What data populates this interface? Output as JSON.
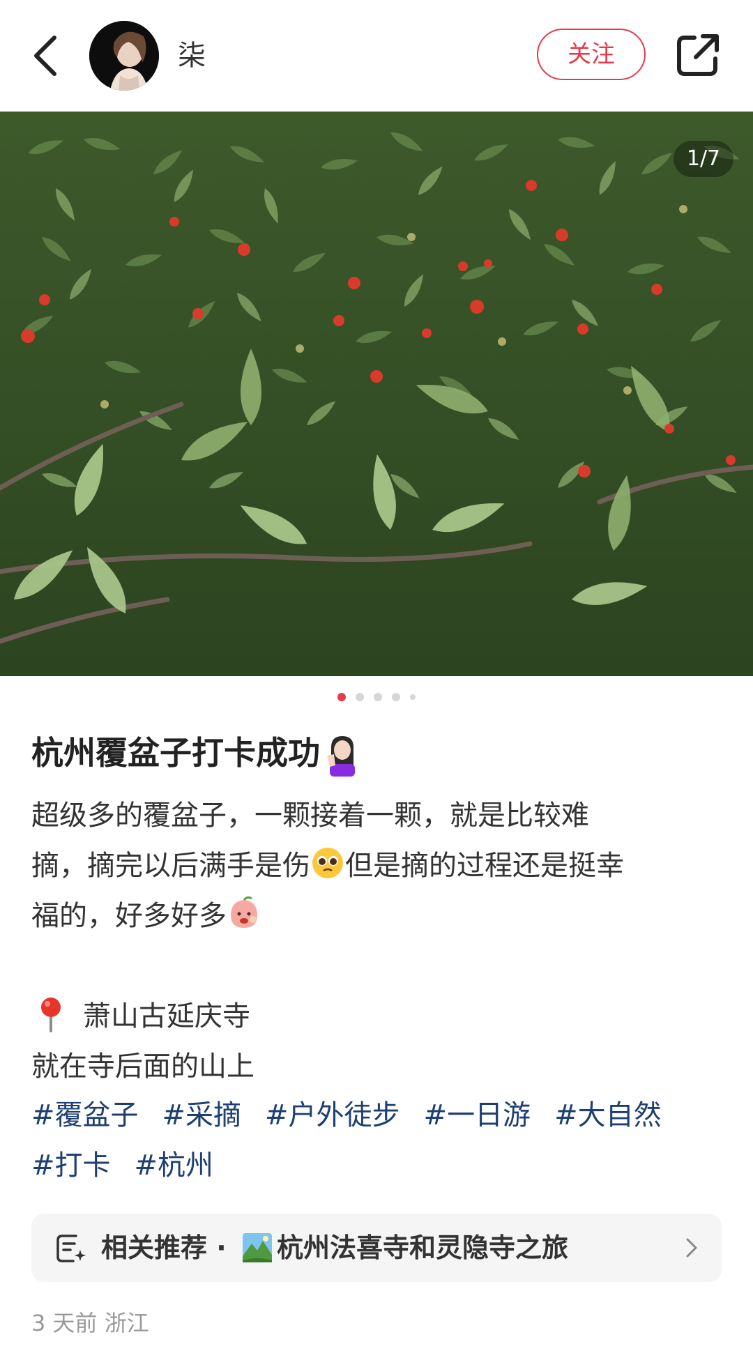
{
  "header": {
    "author_name": "柒",
    "follow_label": "关注",
    "back_icon": "chevron-left-icon",
    "share_icon": "share-icon"
  },
  "photo": {
    "page_counter": "1/7",
    "current_index": 1,
    "total": 7
  },
  "pager_dots": {
    "count": 5,
    "active": 0
  },
  "post": {
    "title": "杭州覆盆子打卡成功",
    "lines": [
      {
        "text": "超级多的覆盆子，一颗接着一颗，就是比较难"
      },
      {
        "text_before": "摘，摘完以后满手是伤",
        "text_after": "但是摘的过程还是挺幸"
      },
      {
        "text": "福的，好多好多"
      }
    ],
    "location": "萧山古延庆寺",
    "location_note": "就在寺后面的山上",
    "tags": [
      "#覆盆子",
      "#采摘",
      "#户外徒步",
      "#一日游",
      "#大自然",
      "#打卡",
      "#杭州"
    ]
  },
  "related": {
    "label": "相关推荐 · ",
    "title": "杭州法喜寺和灵隐寺之旅"
  },
  "meta": {
    "time_location": "3 天前  浙江"
  },
  "colors": {
    "accent": "#e8394d",
    "tag": "#1d3f73",
    "meta": "#999999"
  }
}
